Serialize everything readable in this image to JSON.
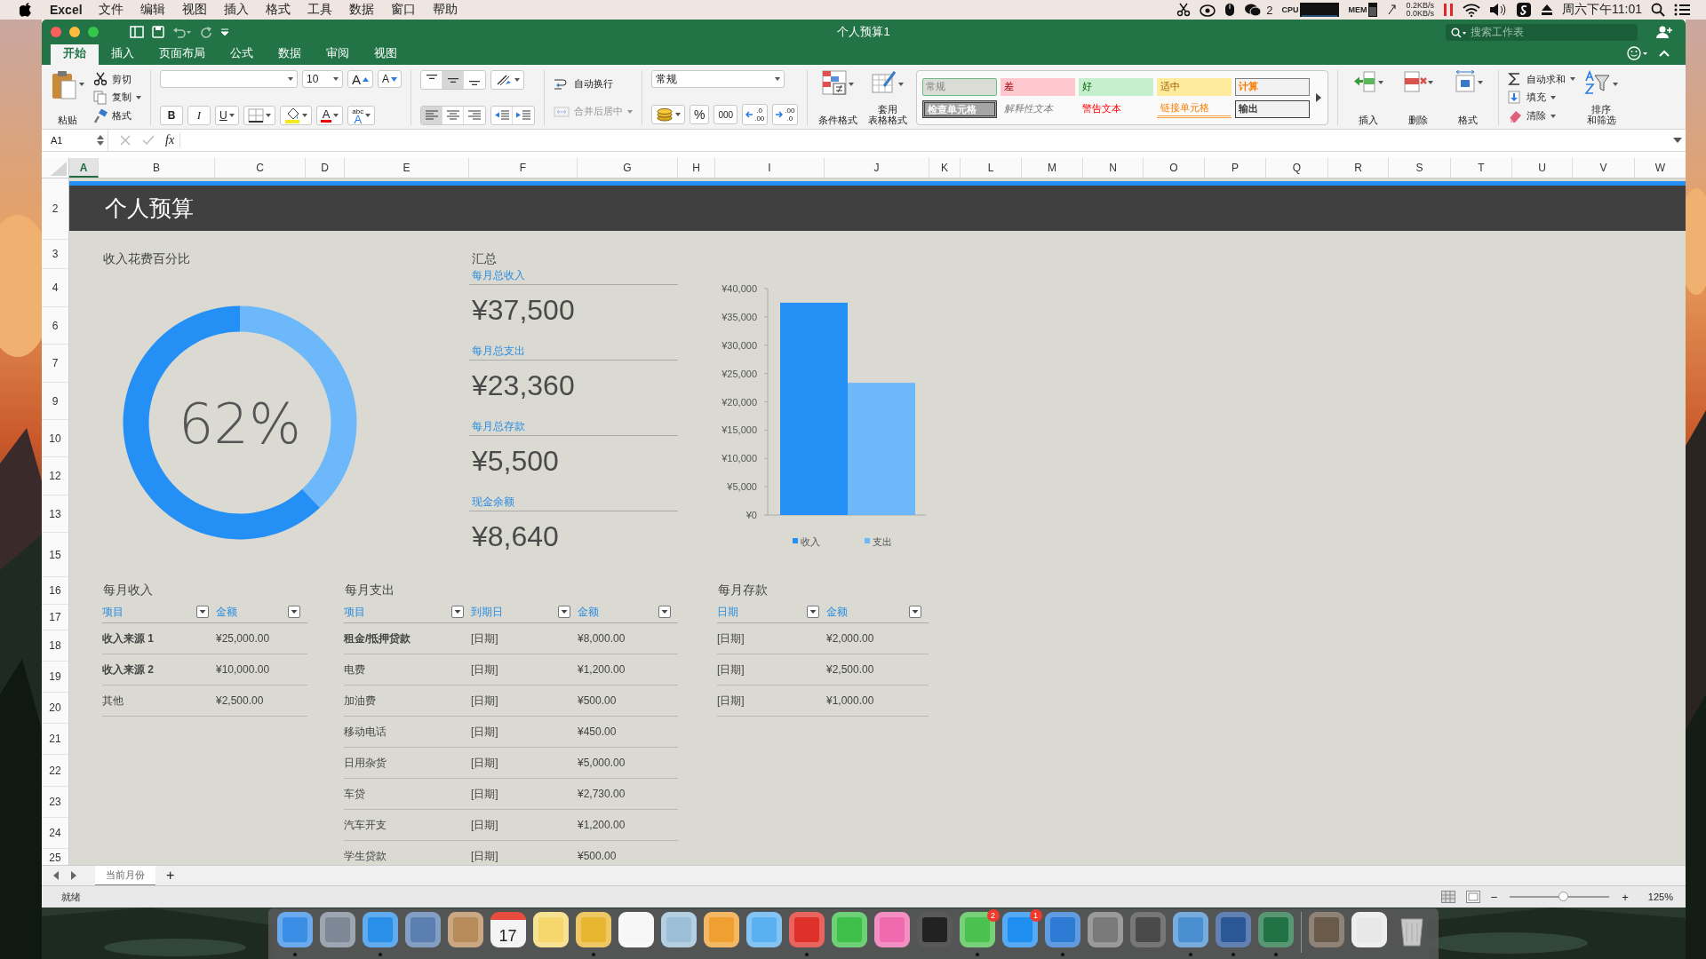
{
  "menu_bar": {
    "app": "Excel",
    "items": [
      "文件",
      "编辑",
      "视图",
      "插入",
      "格式",
      "工具",
      "数据",
      "窗口",
      "帮助"
    ],
    "chat_badge": "2",
    "cpu_label": "CPU",
    "mem_label": "MEM",
    "upload": "0.2KB/s",
    "download": "0.0KB/s",
    "clock": "周六下午11:01"
  },
  "window": {
    "title": "个人预算1",
    "search": {
      "placeholder": "搜索工作表"
    }
  },
  "tabs": [
    {
      "label": "开始",
      "selected": true
    },
    {
      "label": "插入",
      "selected": false
    },
    {
      "label": "页面布局",
      "selected": false
    },
    {
      "label": "公式",
      "selected": false
    },
    {
      "label": "数据",
      "selected": false
    },
    {
      "label": "审阅",
      "selected": false
    },
    {
      "label": "视图",
      "selected": false
    }
  ],
  "ribbon": {
    "paste": "粘贴",
    "clipboard": [
      {
        "kind": "cut",
        "label": "剪切"
      },
      {
        "kind": "copy",
        "label": "复制"
      },
      {
        "kind": "format_painter",
        "label": "格式"
      }
    ],
    "font": {
      "size": "10",
      "grow": "A",
      "shrink": "A",
      "bold": "B",
      "italic": "I",
      "underline": "U",
      "font_color": "A",
      "phonetic": [
        "abc",
        "A"
      ]
    },
    "vertical_align": [
      {
        "kind": "top",
        "selected": false
      },
      {
        "kind": "middle",
        "selected": true
      },
      {
        "kind": "bottom",
        "selected": false
      }
    ],
    "horizontal_align": [
      {
        "kind": "left",
        "selected": true
      },
      {
        "kind": "center",
        "selected": false
      },
      {
        "kind": "right",
        "selected": false
      }
    ],
    "wrap_text": {
      "label": "自动换行",
      "disabled": false
    },
    "merge": {
      "label": "合并后居中",
      "disabled": true
    },
    "number_format": "常规",
    "percent": "%",
    "comma": "000",
    "increase_decimal": [
      ".0",
      ".00"
    ],
    "decrease_decimal": [
      ".00",
      ".0"
    ],
    "conditional_format": [
      "条件格式"
    ],
    "format_as_table": [
      "套用",
      "表格格式"
    ],
    "styles": [
      {
        "label": "常规",
        "kind": "normal",
        "selected": true
      },
      {
        "label": "差",
        "kind": "bad",
        "selected": false
      },
      {
        "label": "好",
        "kind": "good",
        "selected": false
      },
      {
        "label": "适中",
        "kind": "neutral",
        "selected": false
      },
      {
        "label": "计算",
        "kind": "calculation",
        "selected": false
      },
      {
        "label": "检查单元格",
        "kind": "check",
        "selected": false
      },
      {
        "label": "解释性文本",
        "kind": "explanatory",
        "selected": false
      },
      {
        "label": "警告文本",
        "kind": "warning",
        "selected": false
      },
      {
        "label": "链接单元格",
        "kind": "linked",
        "selected": false
      },
      {
        "label": "输出",
        "kind": "output",
        "selected": false
      }
    ],
    "cells": [
      {
        "kind": "insert",
        "label": "插入"
      },
      {
        "kind": "delete",
        "label": "删除"
      },
      {
        "kind": "format",
        "label": "格式"
      }
    ],
    "editing": [
      {
        "kind": "autosum",
        "label": "自动求和"
      },
      {
        "kind": "fill",
        "label": "填充"
      },
      {
        "kind": "clear",
        "label": "清除"
      }
    ],
    "sort_filter": [
      "排序",
      "和筛选"
    ]
  },
  "formula_bar": {
    "name_box": "A1",
    "fx": "fx"
  },
  "columns": [
    {
      "label": "A",
      "selected": true
    },
    {
      "label": "B",
      "selected": false
    },
    {
      "label": "C",
      "selected": false
    },
    {
      "label": "D",
      "selected": false
    },
    {
      "label": "E",
      "selected": false
    },
    {
      "label": "F",
      "selected": false
    },
    {
      "label": "G",
      "selected": false
    },
    {
      "label": "H",
      "selected": false
    },
    {
      "label": "I",
      "selected": false
    },
    {
      "label": "J",
      "selected": false
    },
    {
      "label": "K",
      "selected": false
    },
    {
      "label": "L",
      "selected": false
    },
    {
      "label": "M",
      "selected": false
    },
    {
      "label": "N",
      "selected": false
    },
    {
      "label": "O",
      "selected": false
    },
    {
      "label": "P",
      "selected": false
    },
    {
      "label": "Q",
      "selected": false
    },
    {
      "label": "R",
      "selected": false
    },
    {
      "label": "S",
      "selected": false
    },
    {
      "label": "T",
      "selected": false
    },
    {
      "label": "U",
      "selected": false
    },
    {
      "label": "V",
      "selected": false
    },
    {
      "label": "W",
      "selected": false
    }
  ],
  "rows": [
    "2",
    "3",
    "4",
    "6",
    "7",
    "9",
    "10",
    "12",
    "13",
    "15",
    "16",
    "17",
    "18",
    "19",
    "20",
    "21",
    "22",
    "23",
    "24",
    "25"
  ],
  "sheet": {
    "title": "个人预算",
    "donut": {
      "title": "收入花费百分比",
      "reading": "62%",
      "chart_data": {
        "type": "donut",
        "values": [
          62,
          38
        ]
      }
    },
    "summary": {
      "title": "汇总",
      "items": [
        {
          "label": "每月总收入",
          "value": "¥37,500"
        },
        {
          "label": "每月总支出",
          "value": "¥23,360"
        },
        {
          "label": "每月总存款",
          "value": "¥5,500"
        },
        {
          "label": "现金余额",
          "value": "¥8,640"
        }
      ]
    },
    "chart_data": {
      "type": "bar",
      "legend": "bottom",
      "ylim": [
        0,
        40000
      ],
      "yticks": [
        {
          "value": 0,
          "label": "¥0"
        },
        {
          "value": 5000,
          "label": "¥5,000"
        },
        {
          "value": 10000,
          "label": "¥10,000"
        },
        {
          "value": 15000,
          "label": "¥15,000"
        },
        {
          "value": 20000,
          "label": "¥20,000"
        },
        {
          "value": 25000,
          "label": "¥25,000"
        },
        {
          "value": 30000,
          "label": "¥30,000"
        },
        {
          "value": 35000,
          "label": "¥35,000"
        },
        {
          "value": 40000,
          "label": "¥40,000"
        }
      ],
      "series": [
        {
          "name": "收入",
          "color": "#2490f5",
          "values": [
            37500
          ]
        },
        {
          "name": "支出",
          "color": "#6cb8fb",
          "values": [
            23360
          ]
        }
      ]
    },
    "tables": [
      {
        "title": "每月收入",
        "columns": [
          "项目",
          "金额"
        ],
        "rows": [
          {
            "cells": [
              "收入来源 1",
              "¥25,000.00"
            ],
            "bold": true
          },
          {
            "cells": [
              "收入来源 2",
              "¥10,000.00"
            ],
            "bold": true
          },
          {
            "cells": [
              "其他",
              "¥2,500.00"
            ],
            "bold": false
          }
        ]
      },
      {
        "title": "每月支出",
        "columns": [
          "项目",
          "到期日",
          "金额"
        ],
        "rows": [
          {
            "cells": [
              "租金/抵押贷款",
              "[日期]",
              "¥8,000.00"
            ],
            "bold": true
          },
          {
            "cells": [
              "电费",
              "[日期]",
              "¥1,200.00"
            ],
            "bold": false
          },
          {
            "cells": [
              "加油费",
              "[日期]",
              "¥500.00"
            ],
            "bold": false
          },
          {
            "cells": [
              "移动电话",
              "[日期]",
              "¥450.00"
            ],
            "bold": false
          },
          {
            "cells": [
              "日用杂货",
              "[日期]",
              "¥5,000.00"
            ],
            "bold": false
          },
          {
            "cells": [
              "车贷",
              "[日期]",
              "¥2,730.00"
            ],
            "bold": false
          },
          {
            "cells": [
              "汽车开支",
              "[日期]",
              "¥1,200.00"
            ],
            "bold": false
          },
          {
            "cells": [
              "学生贷款",
              "[日期]",
              "¥500.00"
            ],
            "bold": false
          }
        ]
      },
      {
        "title": "每月存款",
        "columns": [
          "日期",
          "金额"
        ],
        "rows": [
          {
            "cells": [
              "[日期]",
              "¥2,000.00"
            ],
            "bold": false
          },
          {
            "cells": [
              "[日期]",
              "¥2,500.00"
            ],
            "bold": false
          },
          {
            "cells": [
              "[日期]",
              "¥1,000.00"
            ],
            "bold": false
          }
        ]
      }
    ]
  },
  "sheet_tabs": [
    {
      "label": "当前月份",
      "selected": true
    }
  ],
  "add_sheet": "+",
  "status_bar": {
    "text": "就绪",
    "zoom_out": "−",
    "zoom_in": "+",
    "zoom": {
      "level": 0.53,
      "reading": "125%"
    }
  },
  "dock": {
    "apps": [
      {
        "kind": "app",
        "color": "#3a8ee6",
        "running": true
      },
      {
        "kind": "app",
        "color": "#7d8896",
        "running": false
      },
      {
        "kind": "app",
        "color": "#2a8fe8",
        "running": true
      },
      {
        "kind": "app",
        "color": "#5a7fb0",
        "running": false
      },
      {
        "kind": "app",
        "color": "#b88b5a",
        "running": false
      },
      {
        "kind": "calendar",
        "color": "#f4f4f4",
        "running": false,
        "date": "17"
      },
      {
        "kind": "app",
        "color": "#f5d76e",
        "running": false
      },
      {
        "kind": "app",
        "color": "#e8b631",
        "running": true
      },
      {
        "kind": "app",
        "color": "#f6f6f6",
        "running": false
      },
      {
        "kind": "app",
        "color": "#9cbfd8",
        "running": false
      },
      {
        "kind": "app",
        "color": "#f0a030",
        "running": false
      },
      {
        "kind": "app",
        "color": "#5ab0f0",
        "running": false
      },
      {
        "kind": "app",
        "color": "#e0302a",
        "running": true
      },
      {
        "kind": "app",
        "color": "#3ec04a",
        "running": false
      },
      {
        "kind": "app",
        "color": "#f06ab0",
        "running": false
      },
      {
        "kind": "app",
        "color": "#222222",
        "running": false
      },
      {
        "kind": "app",
        "color": "#4bc14f",
        "running": true,
        "badge": "2"
      },
      {
        "kind": "app",
        "color": "#1e8ef0",
        "running": false,
        "badge": "1"
      },
      {
        "kind": "app",
        "color": "#2e7bd6",
        "running": true
      },
      {
        "kind": "app",
        "color": "#7a7a7a",
        "running": false
      },
      {
        "kind": "app",
        "color": "#4a4a4a",
        "running": false
      },
      {
        "kind": "app",
        "color": "#4a90d0",
        "running": true
      },
      {
        "kind": "app",
        "color": "#2b5797",
        "running": true
      },
      {
        "kind": "app",
        "color": "#217346",
        "running": true
      }
    ],
    "docs": [
      {
        "kind": "app",
        "color": "#6a5a4a",
        "running": false
      },
      {
        "kind": "app",
        "color": "#e8e8e8",
        "running": false
      },
      {
        "kind": "trash",
        "color": "#c8c8c8",
        "running": false
      }
    ]
  }
}
